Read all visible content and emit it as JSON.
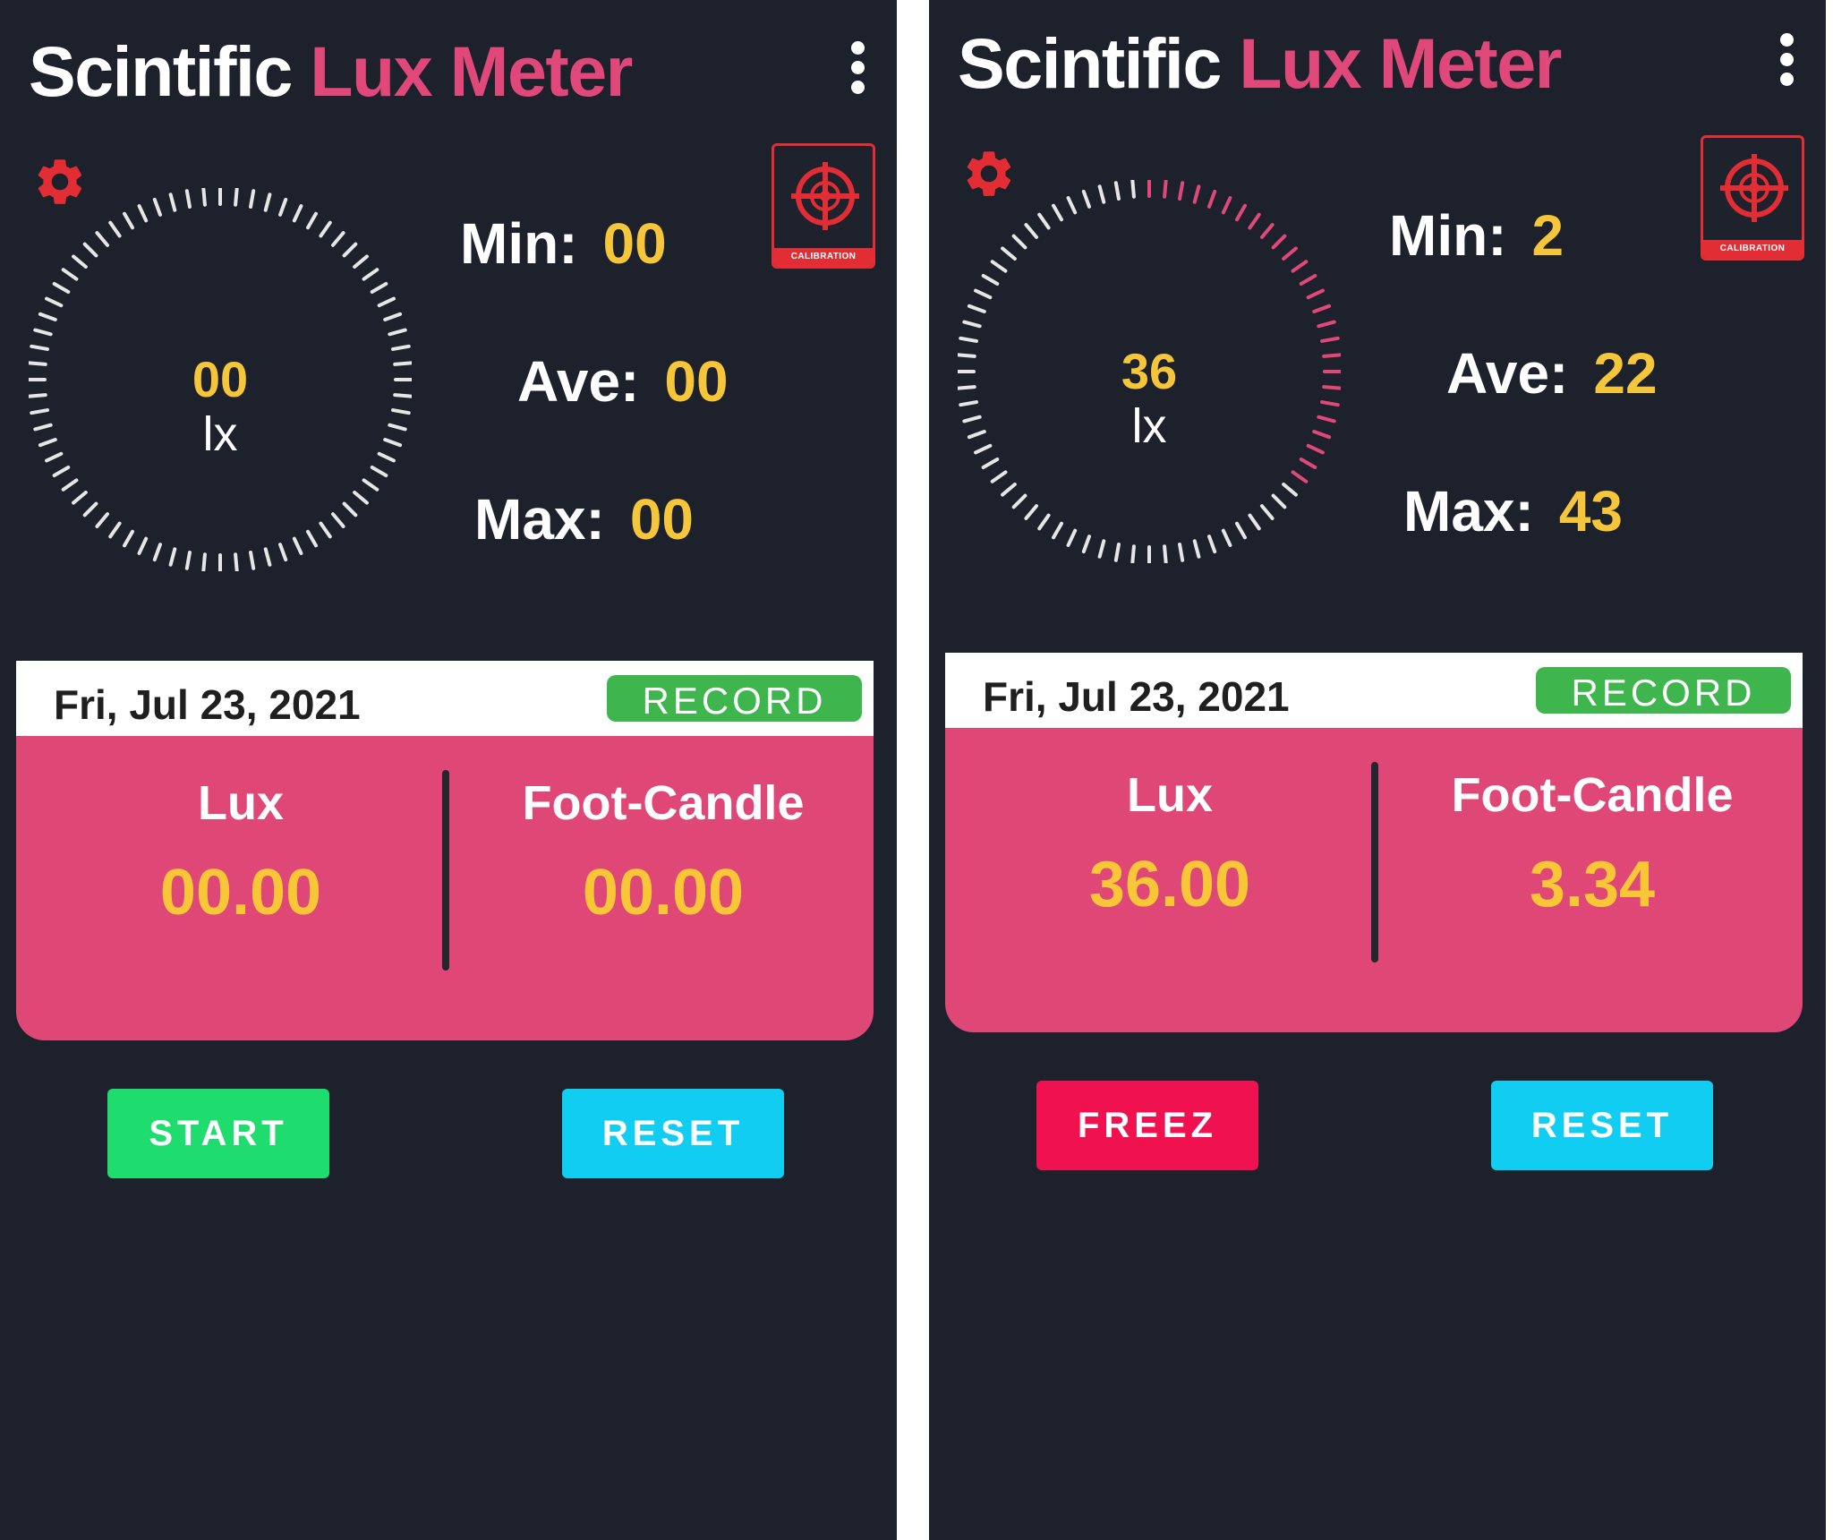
{
  "colors": {
    "background": "#1d212c",
    "title_white": "#ffffff",
    "accent_pink": "#e0487a",
    "value_yellow": "#f5c53a",
    "card_pink": "#df4777",
    "record_green": "#3fb54e",
    "start_green": "#1edc6e",
    "freez_red": "#ef1150",
    "reset_cyan": "#11cdf2",
    "gauge_tick_active": "#e0487a",
    "gauge_tick_idle": "#e6e6e6"
  },
  "screens": [
    {
      "app_title": {
        "part1": "Scintific",
        "part2": "Lux Meter"
      },
      "icons": {
        "menu": "more-vert-icon",
        "settings": "gear-icon",
        "calibration": "crosshair-icon"
      },
      "calibration_label": "CALIBRATION",
      "gauge": {
        "value": "00",
        "unit": "lx",
        "active_fraction": 0
      },
      "stats": {
        "min": {
          "label": "Min:",
          "value": "00"
        },
        "ave": {
          "label": "Ave:",
          "value": "00"
        },
        "max": {
          "label": "Max:",
          "value": "00"
        }
      },
      "date": "Fri, Jul 23, 2021",
      "record_label": "RECORD",
      "readings": {
        "lux": {
          "label": "Lux",
          "value": "00.00"
        },
        "foot_candle": {
          "label": "Foot-Candle",
          "value": "00.00"
        }
      },
      "primary_button": {
        "label": "START",
        "kind": "start"
      },
      "reset_button": "RESET"
    },
    {
      "app_title": {
        "part1": "Scintific",
        "part2": "Lux Meter"
      },
      "icons": {
        "menu": "more-vert-icon",
        "settings": "gear-icon",
        "calibration": "crosshair-icon"
      },
      "calibration_label": "CALIBRATION",
      "gauge": {
        "value": "36",
        "unit": "lx",
        "active_fraction": 0.36
      },
      "stats": {
        "min": {
          "label": "Min:",
          "value": "2"
        },
        "ave": {
          "label": "Ave:",
          "value": "22"
        },
        "max": {
          "label": "Max:",
          "value": "43"
        }
      },
      "date": "Fri, Jul 23, 2021",
      "record_label": "RECORD",
      "readings": {
        "lux": {
          "label": "Lux",
          "value": "36.00"
        },
        "foot_candle": {
          "label": "Foot-Candle",
          "value": "3.34"
        }
      },
      "primary_button": {
        "label": "FREEZ",
        "kind": "freez"
      },
      "reset_button": "RESET"
    }
  ]
}
